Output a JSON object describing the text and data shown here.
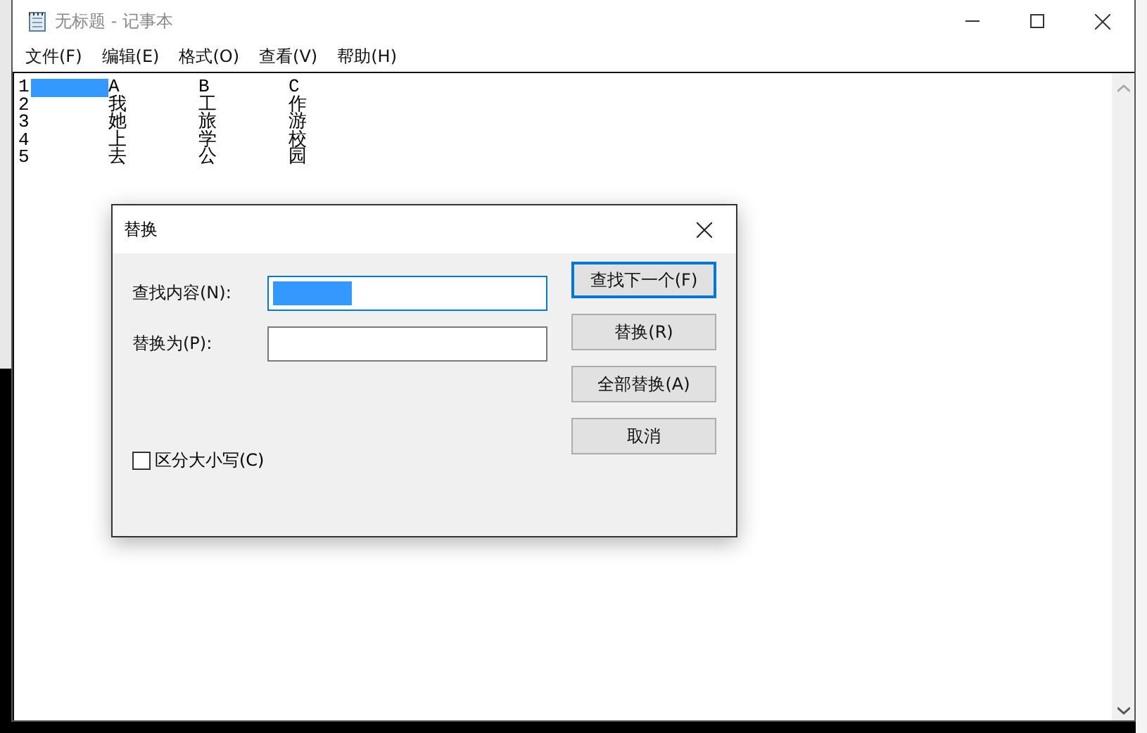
{
  "window": {
    "title": "无标题 - 记事本"
  },
  "menu": [
    "文件(F)",
    "编辑(E)",
    "格式(O)",
    "查看(V)",
    "帮助(H)"
  ],
  "editor": {
    "lines": [
      {
        "cells": [
          "1",
          "A",
          "B",
          "C"
        ],
        "tab_selected": true
      },
      {
        "cells": [
          "2",
          "我",
          "工",
          "作"
        ],
        "tab_selected": false
      },
      {
        "cells": [
          "3",
          "她",
          "旅",
          "游"
        ],
        "tab_selected": false
      },
      {
        "cells": [
          "4",
          "上",
          "学",
          "校"
        ],
        "tab_selected": false
      },
      {
        "cells": [
          "5",
          "去",
          "公",
          "园"
        ],
        "tab_selected": false
      }
    ]
  },
  "dialog": {
    "title": "替换",
    "find": {
      "label": "查找内容(N):",
      "focused": true,
      "selection": true
    },
    "replace": {
      "label": "替换为(P):",
      "focused": false,
      "selection": false
    },
    "match_case": {
      "label": "区分大小写(C)",
      "checked": false
    },
    "buttons": [
      {
        "label": "查找下一个(F)",
        "default": true
      },
      {
        "label": "替换(R)",
        "default": false
      },
      {
        "label": "全部替换(A)",
        "default": false
      },
      {
        "label": "取消",
        "default": false
      }
    ]
  }
}
